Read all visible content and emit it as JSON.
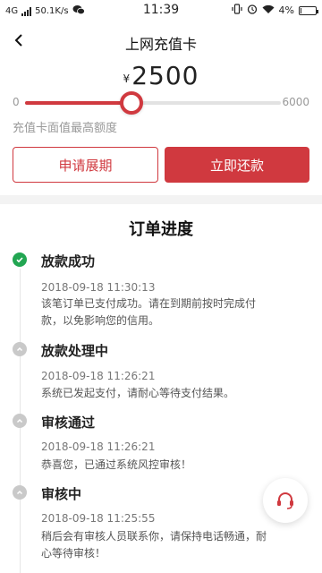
{
  "status_bar": {
    "network": "4G",
    "speed": "50.1K/s",
    "time": "11:39",
    "battery": "4%",
    "battery_level": 0.04
  },
  "nav": {
    "title": "上网充值卡"
  },
  "amount": {
    "currency": "¥",
    "value": "2500"
  },
  "slider": {
    "min": "0",
    "max": "6000",
    "value": 2500,
    "min_value": 0,
    "max_value": 6000
  },
  "hint": "充值卡面值最高额度",
  "buttons": {
    "extend": "申请展期",
    "repay": "立即还款"
  },
  "progress": {
    "title": "订单进度",
    "steps": [
      {
        "title": "放款成功",
        "time": "2018-09-18 11:30:13",
        "desc": "该笔订单已支付成功。请在到期前按时完成付款，以免影响您的信用。",
        "status": "done"
      },
      {
        "title": "放款处理中",
        "time": "2018-09-18 11:26:21",
        "desc": "系统已发起支付，请耐心等待支付结果。",
        "status": "pending"
      },
      {
        "title": "审核通过",
        "time": "2018-09-18 11:26:21",
        "desc": "恭喜您，已通过系统风控审核！",
        "status": "pending"
      },
      {
        "title": "审核中",
        "time": "2018-09-18 11:25:55",
        "desc": "稍后会有审核人员联系你，请保持电话畅通，耐心等待审核！",
        "status": "pending"
      }
    ]
  },
  "colors": {
    "accent": "#d0393f",
    "done": "#22a652",
    "pending": "#c9c9c9"
  },
  "icons": {
    "back": "back-arrow-icon",
    "done": "check-icon",
    "pending": "chevron-up-icon",
    "support": "headset-icon"
  }
}
